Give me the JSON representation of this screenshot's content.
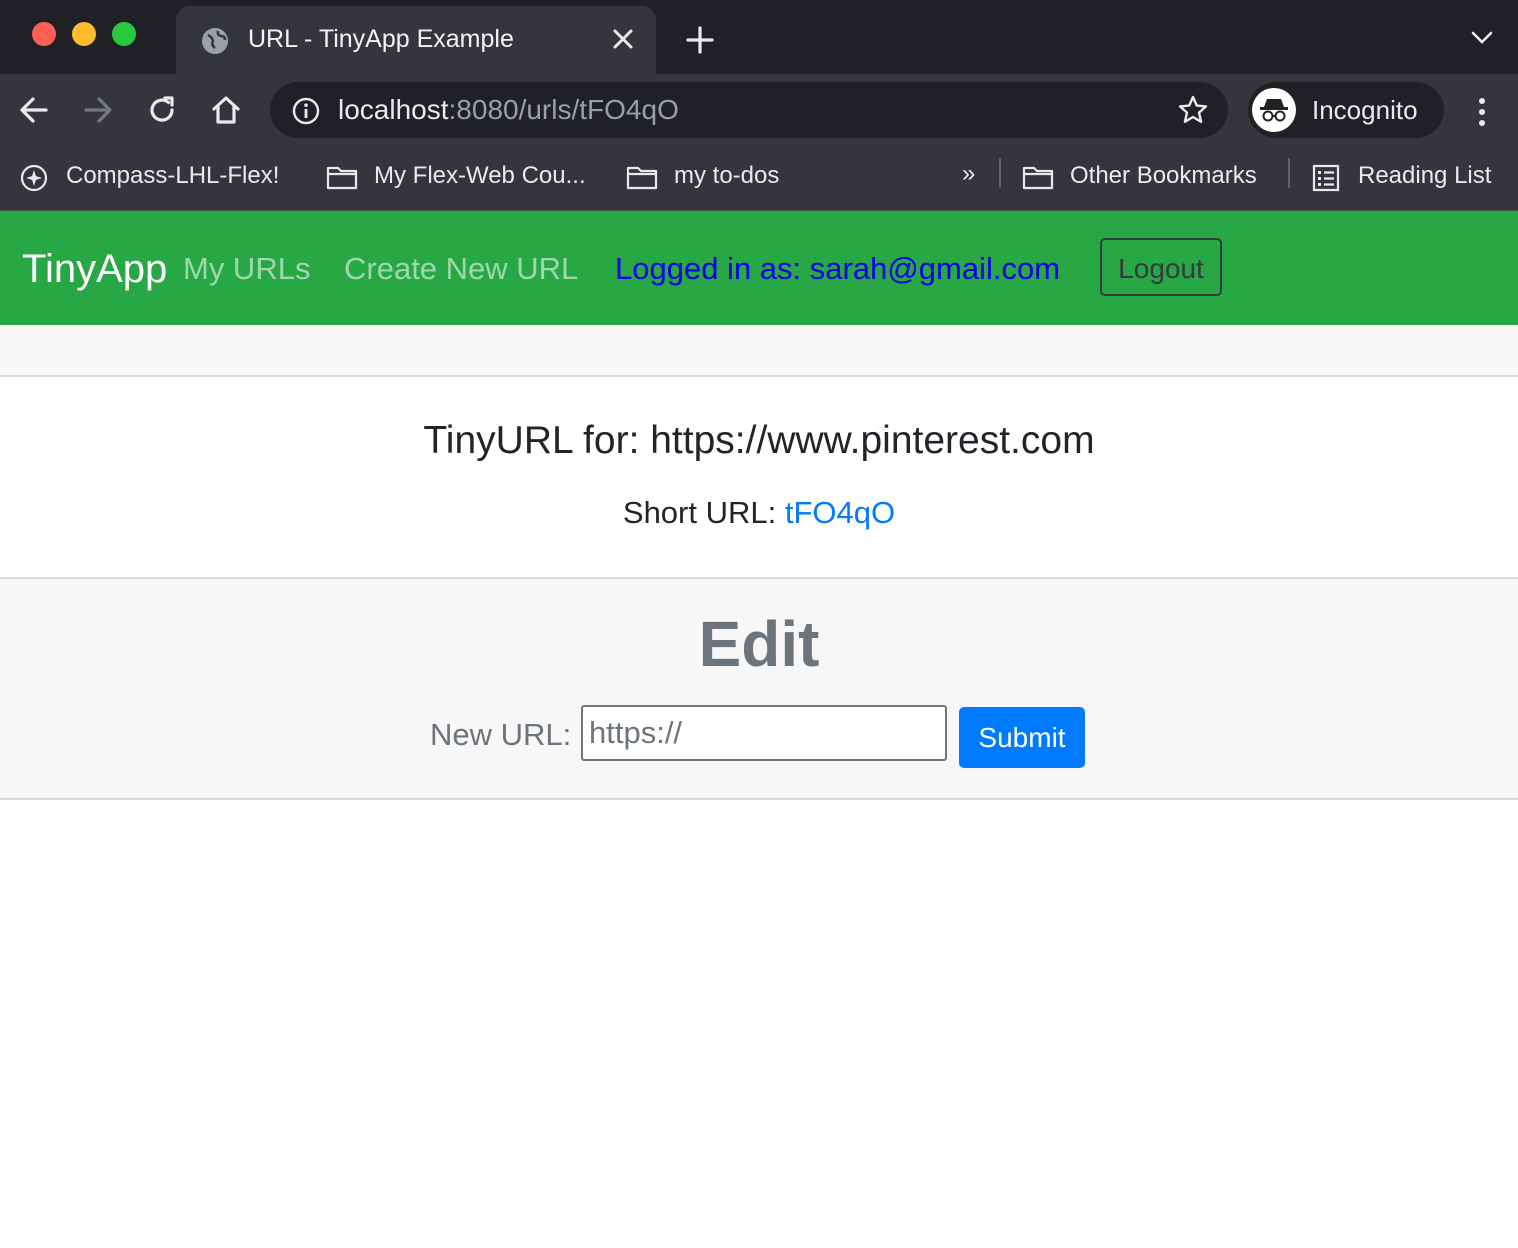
{
  "browser": {
    "tab_title": "URL - TinyApp Example",
    "url_host": "localhost",
    "url_path": ":8080/urls/tFO4qO",
    "profile_label": "Incognito",
    "bookmarks": [
      {
        "label": "Compass-LHL-Flex!",
        "icon": "compass-icon"
      },
      {
        "label": "My Flex-Web Cou...",
        "icon": "folder-icon"
      },
      {
        "label": "my to-dos",
        "icon": "folder-icon"
      }
    ],
    "overflow": "»",
    "other_bookmarks": "Other Bookmarks",
    "reading_list": "Reading List"
  },
  "navbar": {
    "brand": "TinyApp",
    "links": [
      "My URLs",
      "Create New URL"
    ],
    "logged_in": "Logged in as: sarah@gmail.com",
    "logout_label": "Logout",
    "color": "#28a745"
  },
  "card": {
    "title": "TinyURL for: https://www.pinterest.com",
    "short_url_label": "Short URL: ",
    "short_url_value": "tFO4qO",
    "link_color": "#007bff"
  },
  "edit": {
    "heading": "Edit",
    "new_url_label": "New URL:",
    "placeholder": "https://",
    "submit_label": "Submit"
  }
}
